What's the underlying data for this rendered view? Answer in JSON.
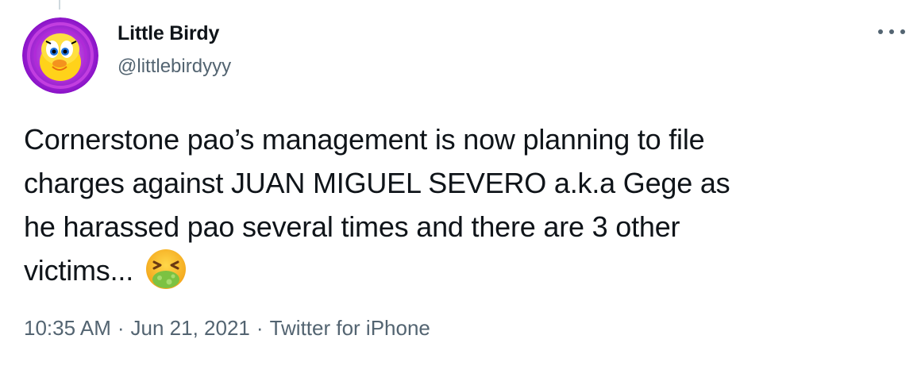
{
  "author": {
    "display_name": "Little Birdy",
    "handle": "@littlebirdyyy"
  },
  "icons": {
    "more": "more-horizontal-icon",
    "emoji": "nauseated-face-emoji",
    "avatar": "tweety-bird-avatar"
  },
  "tweet": {
    "text_lines": [
      "Cornerstone pao’s management is now planning to file",
      "charges against JUAN MIGUEL SEVERO a.k.a Gege as",
      "he harassed pao several times and there are 3 other",
      "victims..."
    ]
  },
  "meta": {
    "time": "10:35 AM",
    "separator": "·",
    "date": "Jun 21, 2021",
    "source": "Twitter for iPhone"
  },
  "colors": {
    "text": "#0f1419",
    "secondary": "#536471",
    "avatar_ring": "#a020d8"
  }
}
